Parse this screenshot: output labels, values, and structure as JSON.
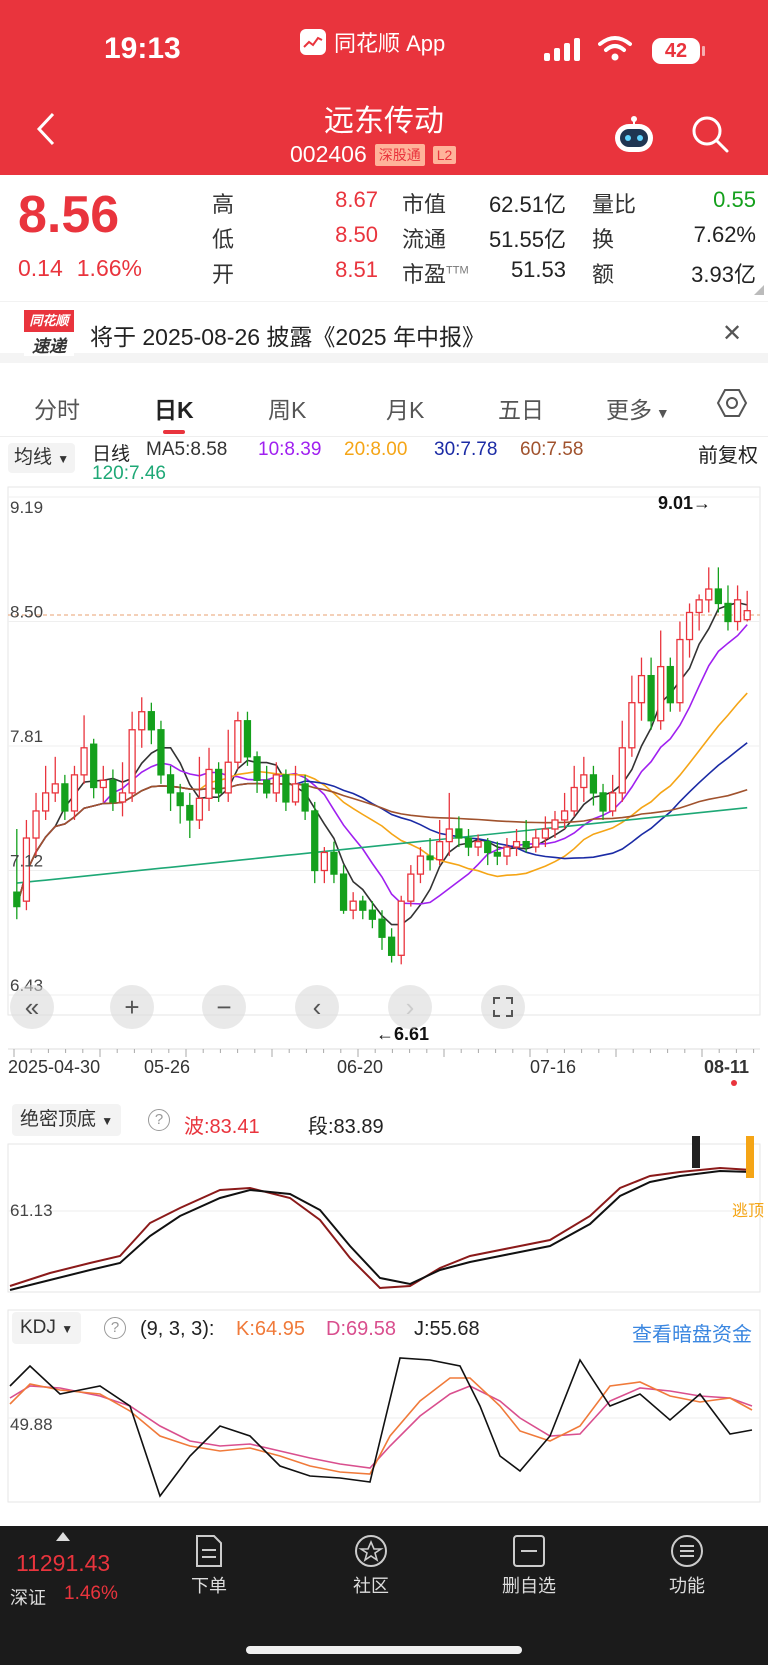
{
  "status_bar": {
    "time": "19:13",
    "app_name": "同花顺 App",
    "battery": "42"
  },
  "header": {
    "title": "远东传动",
    "code": "002406",
    "tags": [
      "深股通",
      "L2"
    ]
  },
  "quote": {
    "price": "8.56",
    "change": "0.14",
    "change_pct": "1.66%",
    "high_label": "高",
    "high": "8.67",
    "low_label": "低",
    "low": "8.50",
    "open_label": "开",
    "open": "8.51",
    "mcap_label": "市值",
    "mcap": "62.51亿",
    "float_label": "流通",
    "float": "51.55亿",
    "pe_label": "市盈",
    "pe_sup": "TTM",
    "pe": "51.53",
    "vr_label": "量比",
    "vr": "0.55",
    "turnover_label": "换",
    "turnover": "7.62%",
    "amount_label": "额",
    "amount": "3.93亿"
  },
  "banner": {
    "logo_top": "同花顺",
    "logo_bottom": "速递",
    "text": "将于 2025-08-26 披露《2025 年中报》"
  },
  "tabs": [
    "分时",
    "日K",
    "周K",
    "月K",
    "五日",
    "更多"
  ],
  "ma": {
    "selector": "均线",
    "label": "日线",
    "ma5": "MA5:8.58",
    "ma10": "10:8.39",
    "ma20": "20:8.00",
    "ma30": "30:7.78",
    "ma60": "60:7.58",
    "ma120": "120:7.46",
    "adjust": "前复权"
  },
  "colors": {
    "up": "#e9343d",
    "down": "#14a01c",
    "ma5": "#333333",
    "ma10": "#a020f0",
    "ma20": "#f5a516",
    "ma30": "#1b2ba5",
    "ma60": "#a0522d",
    "ma120": "#1ea876"
  },
  "chart_axis": {
    "y_ticks": [
      "9.19",
      "8.50",
      "7.81",
      "7.12",
      "6.43"
    ],
    "x_ticks": [
      "2025-04-30",
      "05-26",
      "06-20",
      "07-16",
      "08-11"
    ],
    "max_label": "9.01→",
    "min_label": "←6.61"
  },
  "panel1": {
    "selector": "绝密顶底",
    "wave": "波:83.41",
    "seg": "段:83.89",
    "y_tick": "61.13",
    "signal": "逃顶"
  },
  "panel2": {
    "selector": "KDJ",
    "params": "(9, 3, 3):",
    "k": "K:64.95",
    "d": "D:69.58",
    "j": "J:55.68",
    "link": "查看暗盘资金",
    "y_tick": "49.88"
  },
  "bottom": {
    "index": "11291.43",
    "market": "深证",
    "market_pct": "1.46%",
    "nav": [
      "下单",
      "社区",
      "删自选",
      "功能"
    ]
  },
  "chart_data": {
    "type": "candlestick",
    "x_ticks": [
      "2025-04-30",
      "05-26",
      "06-20",
      "07-16",
      "08-11"
    ],
    "ylim": [
      6.43,
      9.19
    ],
    "y_ticks": [
      9.19,
      8.5,
      7.81,
      7.12,
      6.43
    ],
    "candles": [
      [
        7.0,
        6.92,
        7.35,
        6.85
      ],
      [
        6.95,
        7.3,
        7.4,
        6.9
      ],
      [
        7.3,
        7.45,
        7.55,
        7.2
      ],
      [
        7.45,
        7.55,
        7.7,
        7.4
      ],
      [
        7.55,
        7.6,
        7.75,
        7.5
      ],
      [
        7.6,
        7.45,
        7.65,
        7.4
      ],
      [
        7.45,
        7.65,
        7.7,
        7.4
      ],
      [
        7.65,
        7.8,
        7.98,
        7.6
      ],
      [
        7.82,
        7.58,
        7.85,
        7.52
      ],
      [
        7.58,
        7.62,
        7.7,
        7.5
      ],
      [
        7.62,
        7.5,
        7.68,
        7.45
      ],
      [
        7.5,
        7.55,
        7.72,
        7.42
      ],
      [
        7.55,
        7.9,
        8.0,
        7.5
      ],
      [
        7.9,
        8.0,
        8.08,
        7.8
      ],
      [
        8.0,
        7.9,
        8.05,
        7.82
      ],
      [
        7.9,
        7.65,
        7.95,
        7.6
      ],
      [
        7.65,
        7.55,
        7.7,
        7.45
      ],
      [
        7.55,
        7.48,
        7.6,
        7.38
      ],
      [
        7.48,
        7.4,
        7.55,
        7.3
      ],
      [
        7.4,
        7.52,
        7.75,
        7.35
      ],
      [
        7.52,
        7.68,
        7.8,
        7.45
      ],
      [
        7.68,
        7.55,
        7.72,
        7.5
      ],
      [
        7.55,
        7.72,
        7.9,
        7.5
      ],
      [
        7.72,
        7.95,
        8.0,
        7.68
      ],
      [
        7.95,
        7.75,
        8.0,
        7.7
      ],
      [
        7.75,
        7.62,
        7.78,
        7.55
      ],
      [
        7.62,
        7.55,
        7.7,
        7.52
      ],
      [
        7.55,
        7.65,
        7.72,
        7.5
      ],
      [
        7.65,
        7.5,
        7.68,
        7.45
      ],
      [
        7.5,
        7.6,
        7.7,
        7.48
      ],
      [
        7.6,
        7.45,
        7.65,
        7.4
      ],
      [
        7.45,
        7.12,
        7.5,
        7.05
      ],
      [
        7.12,
        7.22,
        7.25,
        7.05
      ],
      [
        7.22,
        7.1,
        7.28,
        7.05
      ],
      [
        7.1,
        6.9,
        7.15,
        6.88
      ],
      [
        6.9,
        6.95,
        7.0,
        6.85
      ],
      [
        6.95,
        6.9,
        6.98,
        6.85
      ],
      [
        6.9,
        6.85,
        6.95,
        6.8
      ],
      [
        6.85,
        6.75,
        6.9,
        6.68
      ],
      [
        6.75,
        6.65,
        6.8,
        6.61
      ],
      [
        6.65,
        6.95,
        6.98,
        6.6
      ],
      [
        6.95,
        7.1,
        7.15,
        6.92
      ],
      [
        7.1,
        7.2,
        7.25,
        7.05
      ],
      [
        7.2,
        7.18,
        7.3,
        7.12
      ],
      [
        7.18,
        7.28,
        7.4,
        7.15
      ],
      [
        7.28,
        7.35,
        7.55,
        7.2
      ],
      [
        7.35,
        7.3,
        7.42,
        7.25
      ],
      [
        7.3,
        7.25,
        7.35,
        7.2
      ],
      [
        7.25,
        7.28,
        7.32,
        7.2
      ],
      [
        7.28,
        7.22,
        7.3,
        7.15
      ],
      [
        7.22,
        7.2,
        7.28,
        7.15
      ],
      [
        7.2,
        7.25,
        7.3,
        7.15
      ],
      [
        7.25,
        7.28,
        7.35,
        7.2
      ],
      [
        7.28,
        7.25,
        7.4,
        7.22
      ],
      [
        7.25,
        7.3,
        7.35,
        7.22
      ],
      [
        7.3,
        7.35,
        7.42,
        7.25
      ],
      [
        7.35,
        7.4,
        7.45,
        7.3
      ],
      [
        7.4,
        7.45,
        7.55,
        7.35
      ],
      [
        7.45,
        7.58,
        7.7,
        7.42
      ],
      [
        7.58,
        7.65,
        7.75,
        7.5
      ],
      [
        7.65,
        7.55,
        7.7,
        7.48
      ],
      [
        7.55,
        7.45,
        7.6,
        7.4
      ],
      [
        7.45,
        7.55,
        7.65,
        7.42
      ],
      [
        7.55,
        7.8,
        7.95,
        7.5
      ],
      [
        7.8,
        8.05,
        8.2,
        7.75
      ],
      [
        8.05,
        8.2,
        8.3,
        7.95
      ],
      [
        8.2,
        7.95,
        8.3,
        7.9
      ],
      [
        7.95,
        8.25,
        8.45,
        7.9
      ],
      [
        8.25,
        8.05,
        8.3,
        8.0
      ],
      [
        8.05,
        8.4,
        8.5,
        8.0
      ],
      [
        8.4,
        8.55,
        8.6,
        8.3
      ],
      [
        8.55,
        8.62,
        8.65,
        8.45
      ],
      [
        8.62,
        8.68,
        8.8,
        8.55
      ],
      [
        8.68,
        8.6,
        8.8,
        8.55
      ],
      [
        8.6,
        8.5,
        8.7,
        8.45
      ],
      [
        8.5,
        8.62,
        8.7,
        8.45
      ],
      [
        8.51,
        8.56,
        8.67,
        8.5
      ]
    ],
    "ma_lines": [
      "MA5",
      "MA10",
      "MA20",
      "MA30",
      "MA60",
      "MA120"
    ]
  }
}
